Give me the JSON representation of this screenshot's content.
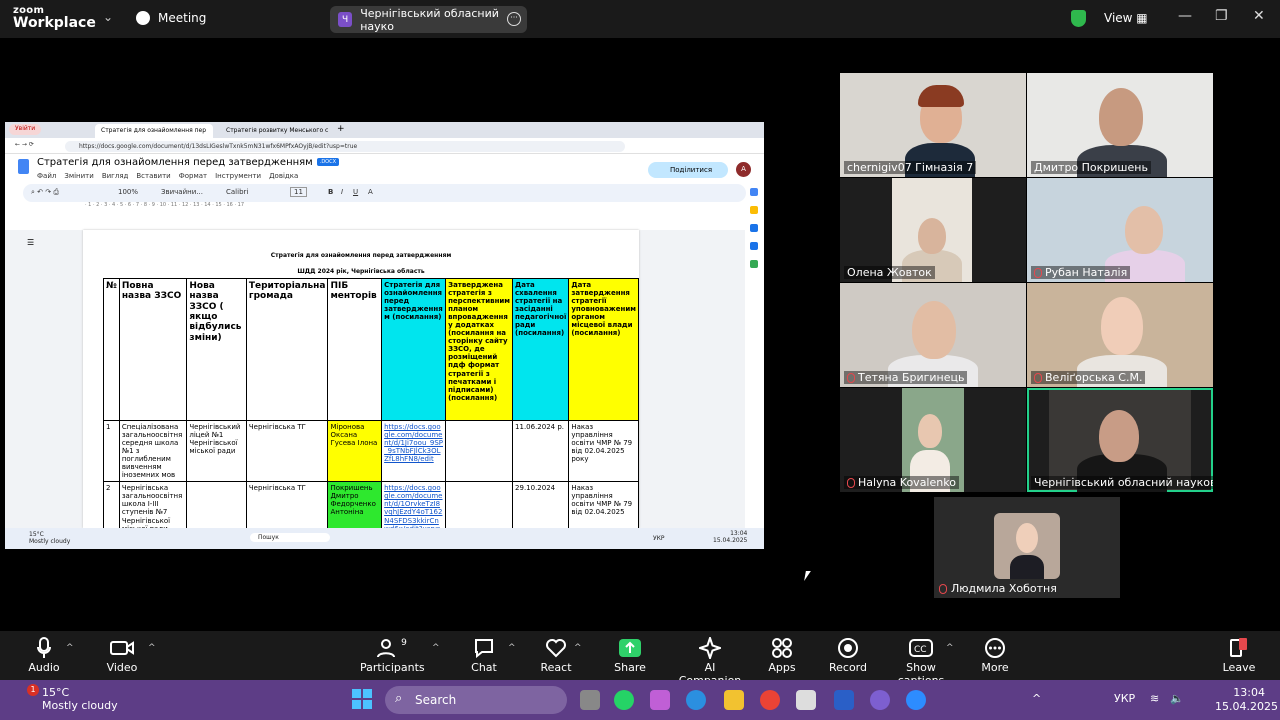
{
  "app": {
    "logo_line1": "zoom",
    "logo_line2": "Workplace",
    "meeting_label": "Meeting",
    "meeting_title": "Чернігівський обласний науко",
    "title_initial": "Ч",
    "view_label": "View"
  },
  "browser": {
    "profile_btn": "Увійти",
    "tabs": [
      "Стратегія для ознайомлення пер",
      "Стратегія розвитку Менського с"
    ],
    "url": "https://docs.google.com/document/d/13dsLIGeslwTxnk5mN31wfx6MPfxAOyjB/edit?usp=true",
    "doc_title": "Стратегія для ознайомлення перед затвердженням",
    "doc_badge": ".DOCX",
    "menus": [
      "Файл",
      "Змінити",
      "Вигляд",
      "Вставити",
      "Формат",
      "Інструменти",
      "Довідка"
    ],
    "share_label": "Поділитися",
    "avatar": "A",
    "toolbar": {
      "zoom": "100%",
      "style": "Звичайни...",
      "font": "Calibri",
      "size": "11"
    }
  },
  "document": {
    "title": "Стратегія для ознайомлення перед затвердженням",
    "subtitle": "ШДД 2024 рік, Чернігівська область",
    "headers": [
      "№",
      "Повна назва ЗЗСО",
      "Нова назва ЗЗСО ( якщо відбулись зміни)",
      "Територіальна громада",
      "ПІБ менторів",
      "Стратегія для ознайомлення перед затвердження м (посилання)",
      "Затверджена стратегія з перспективним планом впровадження у додатках (посилання на сторінку сайту ЗЗСО, де розміщений пдф формат стратегії з печатками і підписами) (посилання)",
      "Дата схвалення стратегії на засіданні педагогічної ради (посилання)",
      "Дата затвердження стратегії уповноваженим органом місцевої влади (посилання)"
    ],
    "rows": [
      {
        "n": "1",
        "name": "Спеціалізована загальноосвітня середня школа №1 з поглибленим вивченням іноземних мов",
        "new": "Чернігівський ліцей №1 Чернігівської міської ради",
        "hromada": "Чернігівська ТГ",
        "mentors": "Міронова Оксана Гусева Ілона",
        "link": "https://docs.google.com/document/d/1Ji7oou_9SP_9sTNbFJlCk3OLZfL8hFN8/edit",
        "approved": "",
        "date_council": "11.06.2024 р.",
        "date_auth": "Наказ управління освіти ЧМР № 79 від 02.04.2025 року"
      },
      {
        "n": "2",
        "name": "Чернігівська загальноосвітня школа І-ІІІ ступенів №7 Чернігівської міської ради Чернігівської області",
        "new": "",
        "hromada": "Чернігівська ТГ",
        "mentors": "Покришень Дмитро Федорченко Антоніна",
        "link": "https://docs.google.com/document/d/1OrvkeTzI8vqhJEzdY4oT162N4SFDS3kkirCnwd6x/edit?usp=sharing",
        "approved": "",
        "date_council": "29.10.2024",
        "date_auth": "Наказ управління освіти ЧМР № 79 від 02.04.2025"
      }
    ]
  },
  "remote_taskbar": {
    "temp": "15°C",
    "weather": "Mostly cloudy",
    "search": "Пошук",
    "lang": "УКР",
    "time": "13:04",
    "date": "15.04.2025"
  },
  "participants": [
    {
      "name": "chernigiv07 Гімназія 7",
      "muted": false
    },
    {
      "name": "Дмитро Покришень",
      "muted": false
    },
    {
      "name": "Олена Жовток",
      "muted": false
    },
    {
      "name": "Рубан Наталія",
      "muted": true
    },
    {
      "name": "Тетяна Бригинець",
      "muted": true
    },
    {
      "name": "Веліґорська С.М.",
      "muted": true
    },
    {
      "name": "Halyna Kovalenko",
      "muted": true
    },
    {
      "name": "Чернігівський обласний науковий лі...",
      "muted": false
    },
    {
      "name": "Людмила Хоботня",
      "muted": true
    }
  ],
  "controls": {
    "audio": "Audio",
    "video": "Video",
    "participants": "Participants",
    "participants_count": "9",
    "chat": "Chat",
    "react": "React",
    "share": "Share",
    "ai": "AI Companion",
    "apps": "Apps",
    "record": "Record",
    "captions": "Show captions",
    "more": "More",
    "leave": "Leave"
  },
  "taskbar": {
    "temp": "15°C",
    "weather": "Mostly cloudy",
    "badge": "1",
    "search": "Search",
    "lang": "УКР",
    "time": "13:04",
    "date": "15.04.2025"
  },
  "colors": {
    "accent_green": "#23d18b",
    "share_green": "#2fd16a",
    "taskbar": "#5d3d86"
  }
}
